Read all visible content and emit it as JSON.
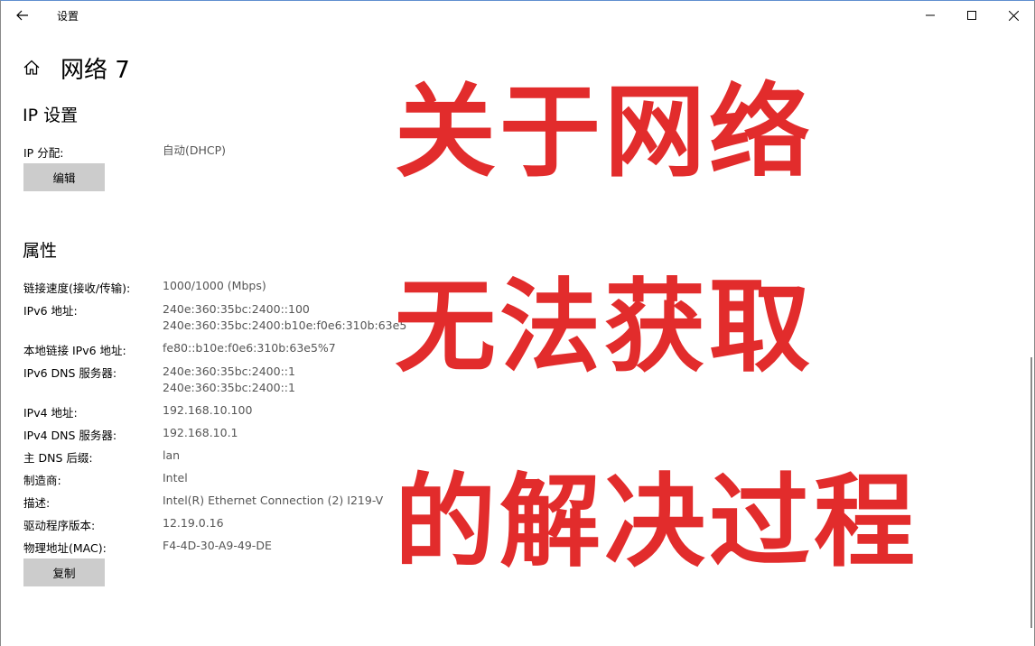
{
  "titlebar": {
    "back_icon": "back-arrow-icon",
    "title": "设置",
    "minimize_icon": "minimize-icon",
    "maximize_icon": "maximize-icon",
    "close_icon": "close-icon"
  },
  "header": {
    "home_icon": "home-icon",
    "title": "网络 7"
  },
  "ip_settings": {
    "section_title": "IP 设置",
    "assignment_label": "IP 分配:",
    "assignment_value": "自动(DHCP)",
    "edit_button": "编辑"
  },
  "properties": {
    "section_title": "属性",
    "rows": [
      {
        "label": "链接速度(接收/传输):",
        "value": "1000/1000 (Mbps)",
        "value2": ""
      },
      {
        "label": "IPv6 地址:",
        "value": "240e:360:35bc:2400::100",
        "value2": "240e:360:35bc:2400:b10e:f0e6:310b:63e5"
      },
      {
        "label": "本地链接 IPv6 地址:",
        "value": "fe80::b10e:f0e6:310b:63e5%7",
        "value2": ""
      },
      {
        "label": "IPv6 DNS 服务器:",
        "value": "240e:360:35bc:2400::1",
        "value2": "240e:360:35bc:2400::1"
      },
      {
        "label": "IPv4 地址:",
        "value": "192.168.10.100",
        "value2": ""
      },
      {
        "label": "IPv4 DNS 服务器:",
        "value": "192.168.10.1",
        "value2": ""
      },
      {
        "label": "主 DNS 后缀:",
        "value": "lan",
        "value2": ""
      },
      {
        "label": "制造商:",
        "value": "Intel",
        "value2": ""
      },
      {
        "label": "描述:",
        "value": "Intel(R) Ethernet Connection (2) I219-V",
        "value2": ""
      },
      {
        "label": "驱动程序版本:",
        "value": "12.19.0.16",
        "value2": ""
      },
      {
        "label": "物理地址(MAC):",
        "value": "F4-4D-30-A9-49-DE",
        "value2": ""
      }
    ],
    "copy_button": "复制"
  },
  "overlay": {
    "line1": "关于网络",
    "line2": "无法获取",
    "line3": "的解决过程",
    "color": "#e22c2c"
  }
}
